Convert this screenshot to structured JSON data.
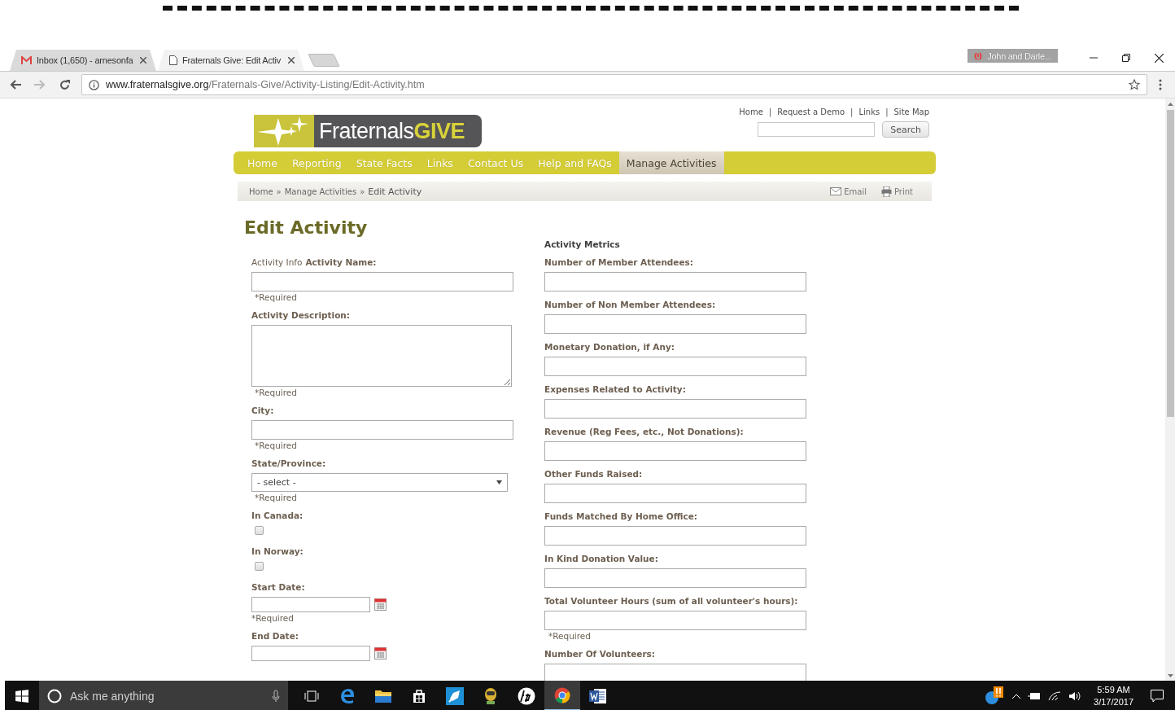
{
  "browser": {
    "tabs": [
      {
        "kind": "mail",
        "title": "Inbox (1,650) - arnesonfa",
        "selected": false
      },
      {
        "kind": "page",
        "title": "Fraternals Give: Edit Activ",
        "selected": true
      }
    ],
    "url": {
      "host": "www.fraternalsgive.org",
      "path": "/Fraternals-Give/Activity-Listing/Edit-Activity.htm"
    },
    "profile": "John and Darle..."
  },
  "site": {
    "top_links": [
      {
        "kind": "link",
        "text": "Home"
      },
      {
        "kind": "separator",
        "text": "|"
      },
      {
        "kind": "link",
        "text": "Request a Demo"
      },
      {
        "kind": "separator",
        "text": "|"
      },
      {
        "kind": "link",
        "text": "Links"
      },
      {
        "kind": "separator",
        "text": "|"
      },
      {
        "kind": "link",
        "text": "Site Map"
      }
    ],
    "search_button": "Search",
    "logo": {
      "text": "Fraternals",
      "accent": "GIVE"
    },
    "nav": [
      {
        "label": "Home",
        "selected": false
      },
      {
        "label": "Reporting",
        "selected": false
      },
      {
        "label": "State Facts",
        "selected": false
      },
      {
        "label": "Links",
        "selected": false
      },
      {
        "label": "Contact Us",
        "selected": false
      },
      {
        "label": "Help and FAQs",
        "selected": false
      },
      {
        "label": "Manage Activities",
        "selected": true
      }
    ],
    "breadcrumb": [
      {
        "kind": "link",
        "text": "Home"
      },
      {
        "kind": "separator",
        "text": "»"
      },
      {
        "kind": "link",
        "text": "Manage Activities"
      },
      {
        "kind": "separator",
        "text": "»"
      },
      {
        "kind": "current",
        "text": "Edit Activity"
      }
    ],
    "page_tools": [
      {
        "kind": "email",
        "label": "Email"
      },
      {
        "kind": "print",
        "label": "Print"
      }
    ]
  },
  "page_title": "Edit Activity",
  "form": {
    "left_fields": [
      {
        "kind": "text",
        "prefix": "Activity Info",
        "label": "Activity Name:",
        "required": "*Required"
      },
      {
        "kind": "textarea",
        "label": "Activity Description:",
        "required": "*Required"
      },
      {
        "kind": "text",
        "label": "City:",
        "required": "*Required"
      },
      {
        "kind": "select",
        "label": "State/Province:",
        "value": "- select -",
        "required": "*Required"
      },
      {
        "kind": "checkbox",
        "label": "In Canada:",
        "checked": false
      },
      {
        "kind": "checkbox",
        "label": "In Norway:",
        "checked": false
      },
      {
        "kind": "date",
        "label": "Start Date:",
        "required": "*Required"
      },
      {
        "kind": "date",
        "label": "End Date:"
      }
    ],
    "metrics_heading": "Activity Metrics",
    "metrics_fields": [
      {
        "label": "Number of Member Attendees:"
      },
      {
        "label": "Number of Non Member Attendees:"
      },
      {
        "label": "Monetary Donation, if Any:"
      },
      {
        "label": "Expenses Related to Activity:"
      },
      {
        "label": "Revenue (Reg Fees, etc., Not Donations):"
      },
      {
        "label": "Other Funds Raised:"
      },
      {
        "label": "Funds Matched By Home Office:"
      },
      {
        "label": "In Kind Donation Value:"
      },
      {
        "label": "Total  Volunteer Hours (sum of all volunteer's hours):",
        "required": "*Required"
      },
      {
        "label": "Number Of Volunteers:"
      }
    ]
  },
  "taskbar": {
    "search_placeholder": "Ask me anything",
    "apps": [
      {
        "kind": "task-view",
        "active": false
      },
      {
        "kind": "edge",
        "active": false
      },
      {
        "kind": "folder",
        "active": false
      },
      {
        "kind": "store",
        "active": false
      },
      {
        "kind": "rocket",
        "active": false
      },
      {
        "kind": "gamepad",
        "active": false
      },
      {
        "kind": "hp",
        "active": false
      },
      {
        "kind": "chrome",
        "active": true
      },
      {
        "kind": "word",
        "active": false
      }
    ],
    "time": "5:59 AM",
    "date": "3/17/2017"
  }
}
